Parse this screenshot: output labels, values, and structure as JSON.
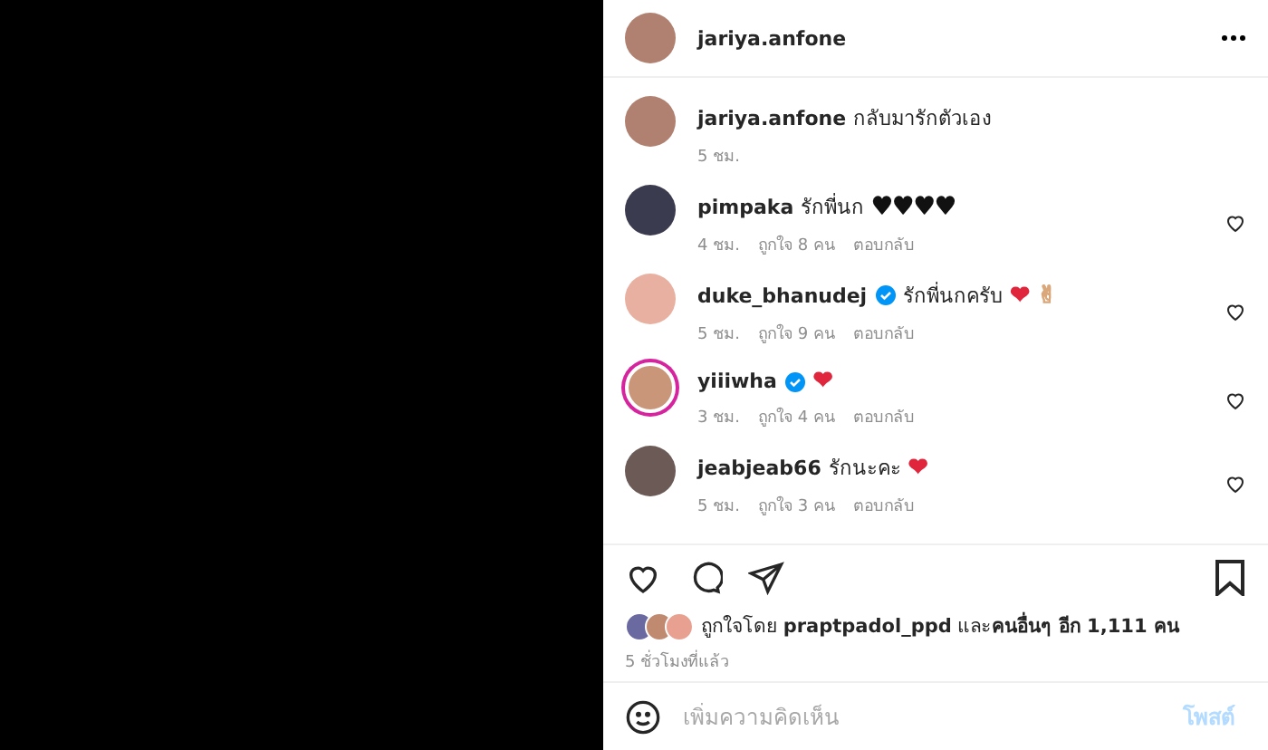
{
  "post": {
    "author": "jariya.anfone",
    "caption": {
      "user": "jariya.anfone",
      "text": "กลับมารักตัวเอง",
      "time": "5 ชม."
    }
  },
  "comments": [
    {
      "user": "pimpaka",
      "verified": false,
      "text": "รักพี่นก",
      "emoji": [
        {
          "char": "♥♥♥♥",
          "color": "#111111"
        }
      ],
      "time": "4 ชม.",
      "likes": "ถูกใจ 8 คน",
      "reply": "ตอบกลับ",
      "ring": false
    },
    {
      "user": "duke_bhanudej",
      "verified": true,
      "text": "รักพี่นกครับ",
      "emoji": [
        {
          "char": "❤",
          "color": "#e0263c"
        },
        {
          "char": "✌",
          "color": "#d9a77a"
        }
      ],
      "time": "5 ชม.",
      "likes": "ถูกใจ 9 คน",
      "reply": "ตอบกลับ",
      "ring": false
    },
    {
      "user": "yiiiwha",
      "verified": true,
      "emoji": [
        {
          "char": "❤",
          "color": "#e0263c"
        }
      ],
      "time": "3 ชม.",
      "likes": "ถูกใจ 4 คน",
      "reply": "ตอบกลับ",
      "ring": true
    },
    {
      "user": "jeabjeab66",
      "verified": false,
      "text": "รักนะคะ",
      "emoji": [
        {
          "char": "❤",
          "color": "#e0263c"
        }
      ],
      "time": "5 ชม.",
      "likes": "ถูกใจ 3 คน",
      "reply": "ตอบกลับ",
      "ring": false
    }
  ],
  "likes": {
    "text": "ถูกใจโดย **praptpadol_ppd** และ**คนอื่นๆ อีก 1,111 คน**",
    "time": "5 ชั่วโมงที่แล้ว"
  },
  "comment_box": {
    "placeholder": "เพิ่มความคิดเห็น",
    "post_label": "โพสต์"
  }
}
